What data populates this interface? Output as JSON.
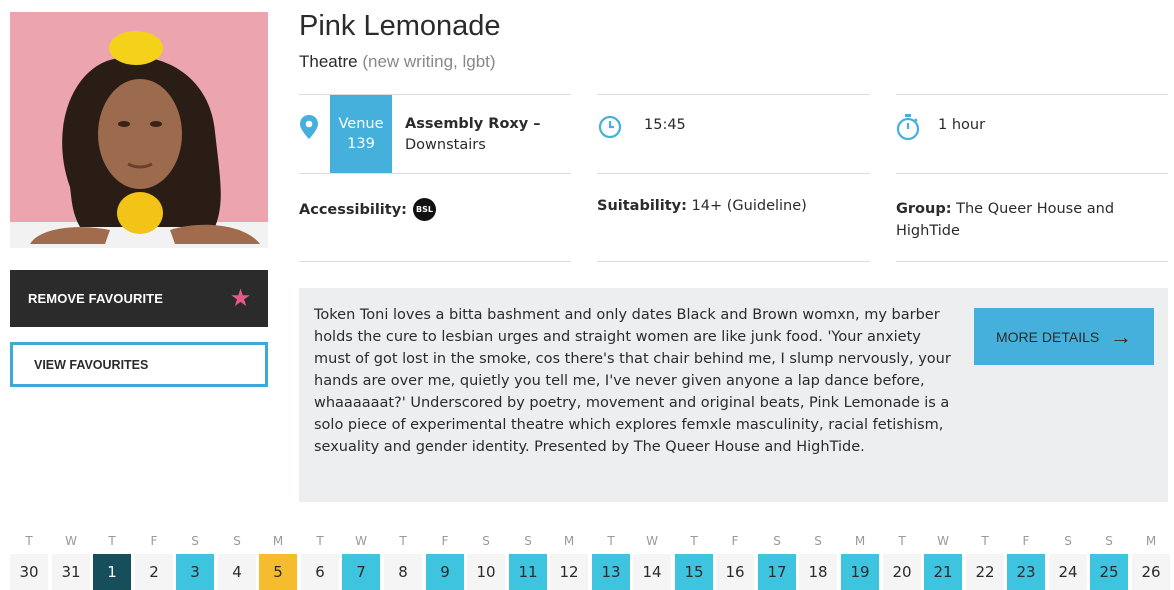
{
  "show": {
    "title": "Pink Lemonade",
    "category": "Theatre",
    "tags": "(new writing, lgbt)"
  },
  "actions": {
    "remove_favourite": "REMOVE FAVOURITE",
    "view_favourites": "VIEW FAVOURITES",
    "more_details": "MORE DETAILS"
  },
  "venue": {
    "badge_word": "Venue",
    "badge_number": "139",
    "name": "Assembly Roxy –",
    "room": "Downstairs"
  },
  "time": "15:45",
  "duration": "1 hour",
  "accessibility": {
    "label": "Accessibility:",
    "badge": "BSL"
  },
  "suitability": {
    "label": "Suitability:",
    "value": " 14+ (Guideline)"
  },
  "group": {
    "label": "Group:",
    "value": " The Queer House and HighTide"
  },
  "description": "Token Toni loves a bitta bashment and only dates Black and Brown womxn, my barber holds the cure to lesbian urges and straight women are like junk food. 'Your anxiety must of got lost in the smoke, cos there's that chair behind me, I slump nervously, your hands are over me, quietly you tell me, I've never given anyone a lap dance before, whaaaaaat?' Underscored by poetry, movement and original beats, Pink Lemonade is a solo piece of experimental theatre which explores femxle masculinity, racial fetishism, sexuality and gender identity. Presented by The Queer House and HighTide.",
  "colors": {
    "accent": "#45b0db",
    "available_day": "#3ec4de",
    "selected_day": "#174e5c",
    "highlight_day": "#f5bd2e",
    "star": "#e25a86"
  },
  "icons": {
    "venue": "map-pin-icon",
    "time": "clock-icon",
    "duration": "stopwatch-icon",
    "favourite": "star-icon",
    "more": "arrow-right-icon"
  },
  "calendar": [
    {
      "dow": "T",
      "day": "30",
      "state": "none"
    },
    {
      "dow": "W",
      "day": "31",
      "state": "none"
    },
    {
      "dow": "T",
      "day": "1",
      "state": "selected"
    },
    {
      "dow": "F",
      "day": "2",
      "state": "none"
    },
    {
      "dow": "S",
      "day": "3",
      "state": "available"
    },
    {
      "dow": "S",
      "day": "4",
      "state": "none"
    },
    {
      "dow": "M",
      "day": "5",
      "state": "highlight"
    },
    {
      "dow": "T",
      "day": "6",
      "state": "none"
    },
    {
      "dow": "W",
      "day": "7",
      "state": "available"
    },
    {
      "dow": "T",
      "day": "8",
      "state": "none"
    },
    {
      "dow": "F",
      "day": "9",
      "state": "available"
    },
    {
      "dow": "S",
      "day": "10",
      "state": "none"
    },
    {
      "dow": "S",
      "day": "11",
      "state": "available"
    },
    {
      "dow": "M",
      "day": "12",
      "state": "none"
    },
    {
      "dow": "T",
      "day": "13",
      "state": "available"
    },
    {
      "dow": "W",
      "day": "14",
      "state": "none"
    },
    {
      "dow": "T",
      "day": "15",
      "state": "available"
    },
    {
      "dow": "F",
      "day": "16",
      "state": "none"
    },
    {
      "dow": "S",
      "day": "17",
      "state": "available"
    },
    {
      "dow": "S",
      "day": "18",
      "state": "none"
    },
    {
      "dow": "M",
      "day": "19",
      "state": "available"
    },
    {
      "dow": "T",
      "day": "20",
      "state": "none"
    },
    {
      "dow": "W",
      "day": "21",
      "state": "available"
    },
    {
      "dow": "T",
      "day": "22",
      "state": "none"
    },
    {
      "dow": "F",
      "day": "23",
      "state": "available"
    },
    {
      "dow": "S",
      "day": "24",
      "state": "none"
    },
    {
      "dow": "S",
      "day": "25",
      "state": "available"
    },
    {
      "dow": "M",
      "day": "26",
      "state": "none"
    }
  ]
}
